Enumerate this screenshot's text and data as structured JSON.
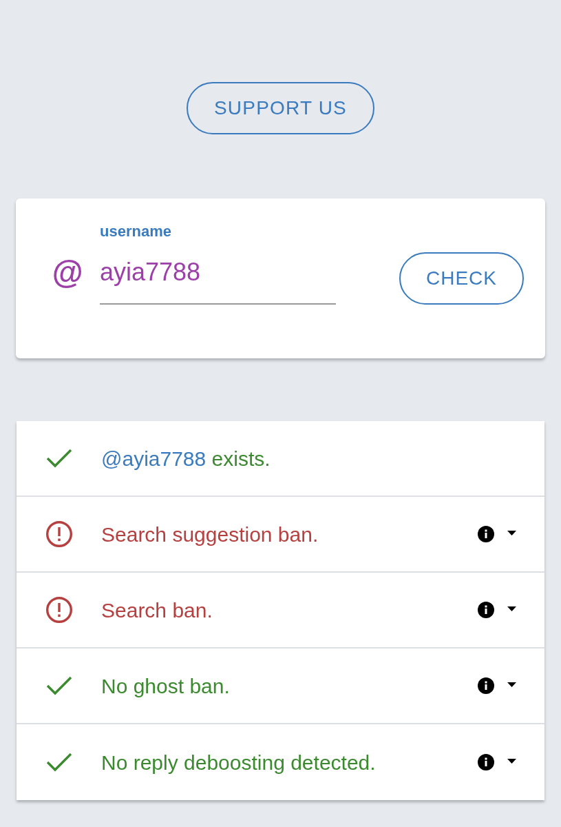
{
  "support_button": {
    "label": "SUPPORT US"
  },
  "username_card": {
    "field": {
      "label": "username",
      "prefix": "@",
      "value": "ayia7788"
    },
    "check_button": {
      "label": "CHECK"
    }
  },
  "results": [
    {
      "kind": "pass",
      "handle": "@ayia7788",
      "text": "exists.",
      "expandable": false
    },
    {
      "kind": "fail",
      "text": "Search suggestion ban.",
      "expandable": true
    },
    {
      "kind": "fail",
      "text": "Search ban.",
      "expandable": true
    },
    {
      "kind": "pass",
      "text": "No ghost ban.",
      "expandable": true
    },
    {
      "kind": "pass",
      "text": "No reply deboosting detected.",
      "expandable": true
    }
  ]
}
